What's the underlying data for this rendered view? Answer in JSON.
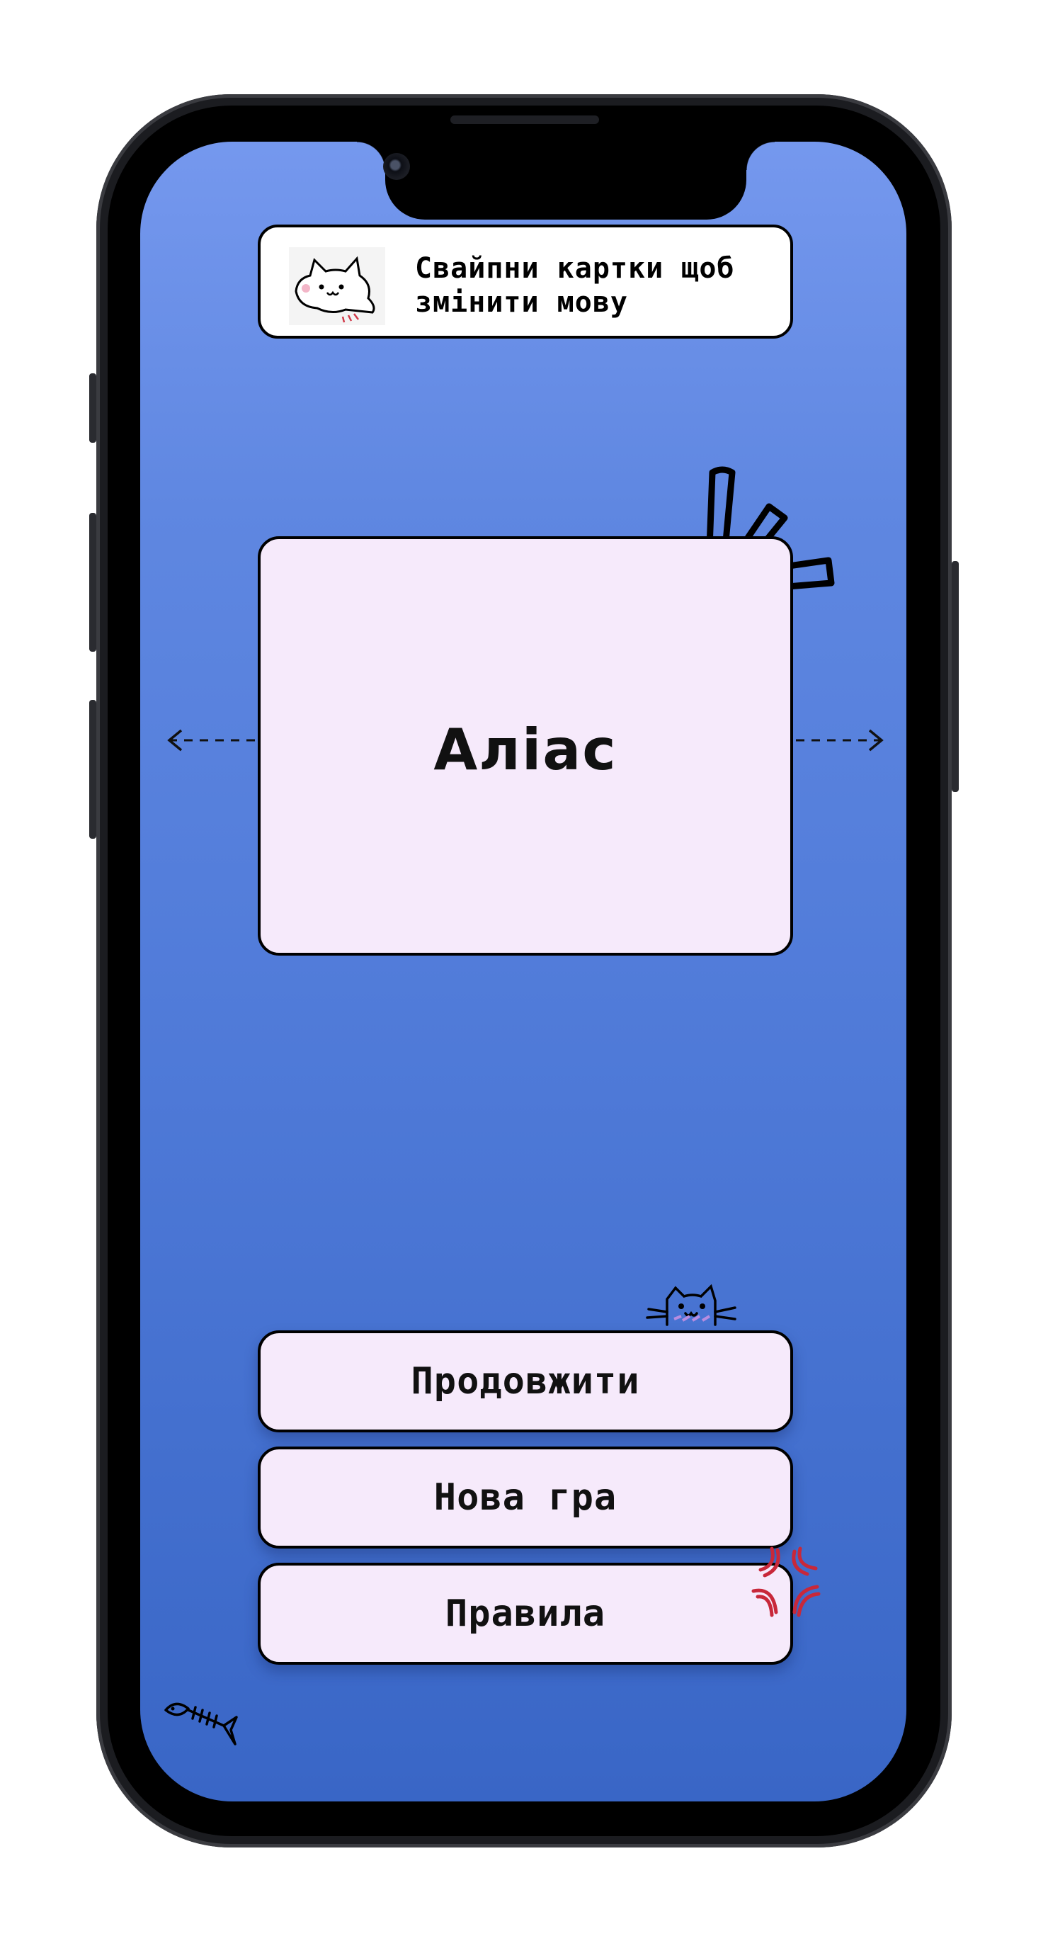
{
  "hint": {
    "line1": "Свайпни картки щоб",
    "line2": "змінити мову",
    "icon": "cat-icon"
  },
  "card": {
    "title": "Аліас"
  },
  "menu": {
    "continue_label": "Продовжити",
    "new_game_label": "Нова гра",
    "rules_label": "Правила"
  },
  "icons": [
    "swipe-left-arrow-icon",
    "swipe-right-arrow-icon",
    "exclamation-marks-icon",
    "peeking-cat-icon",
    "anger-mark-icon",
    "fish-bone-icon"
  ],
  "colors": {
    "background_top": "#7598ee",
    "background_bottom": "#3966c6",
    "card_fill": "#f6eafb",
    "outline": "#000000"
  }
}
